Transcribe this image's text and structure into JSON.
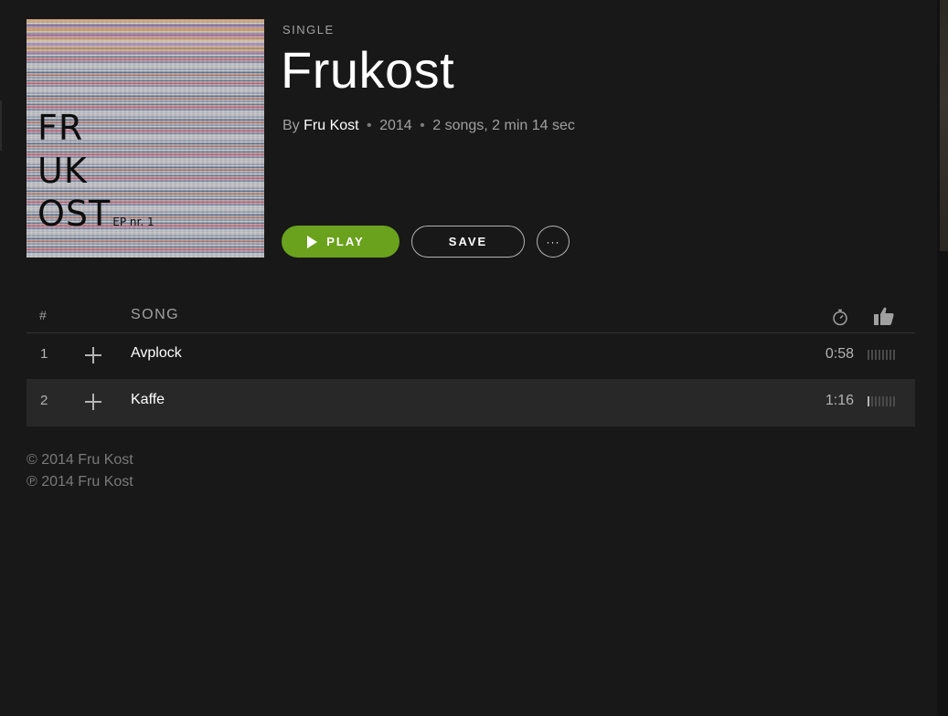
{
  "album": {
    "kind": "SINGLE",
    "title": "Frukost",
    "by_label": "By",
    "artist": "Fru Kost",
    "year": "2014",
    "summary": "2 songs, 2 min 14 sec",
    "separator": "•",
    "cover": {
      "line1": "FR",
      "line2": "UK",
      "line3": "OST",
      "subtitle": "EP nr. 1"
    }
  },
  "actions": {
    "play_label": "PLAY",
    "save_label": "SAVE",
    "more_label": "···"
  },
  "tracklist": {
    "header": {
      "number": "#",
      "song": "SONG",
      "duration_icon": "stopwatch-icon",
      "popularity_icon": "thumbs-up-icon"
    },
    "tracks": [
      {
        "number": "1",
        "name": "Avplock",
        "duration": "0:58",
        "popularity": 0.0
      },
      {
        "number": "2",
        "name": "Kaffe",
        "duration": "1:16",
        "popularity": 0.125
      }
    ]
  },
  "footer": {
    "copyright": "© 2014 Fru Kost",
    "phonographic": "℗ 2014 Fru Kost"
  },
  "colors": {
    "background": "#181818",
    "play_green": "#6aa21e",
    "highlight_row": "#282828",
    "muted_text": "#a0a0a0"
  }
}
